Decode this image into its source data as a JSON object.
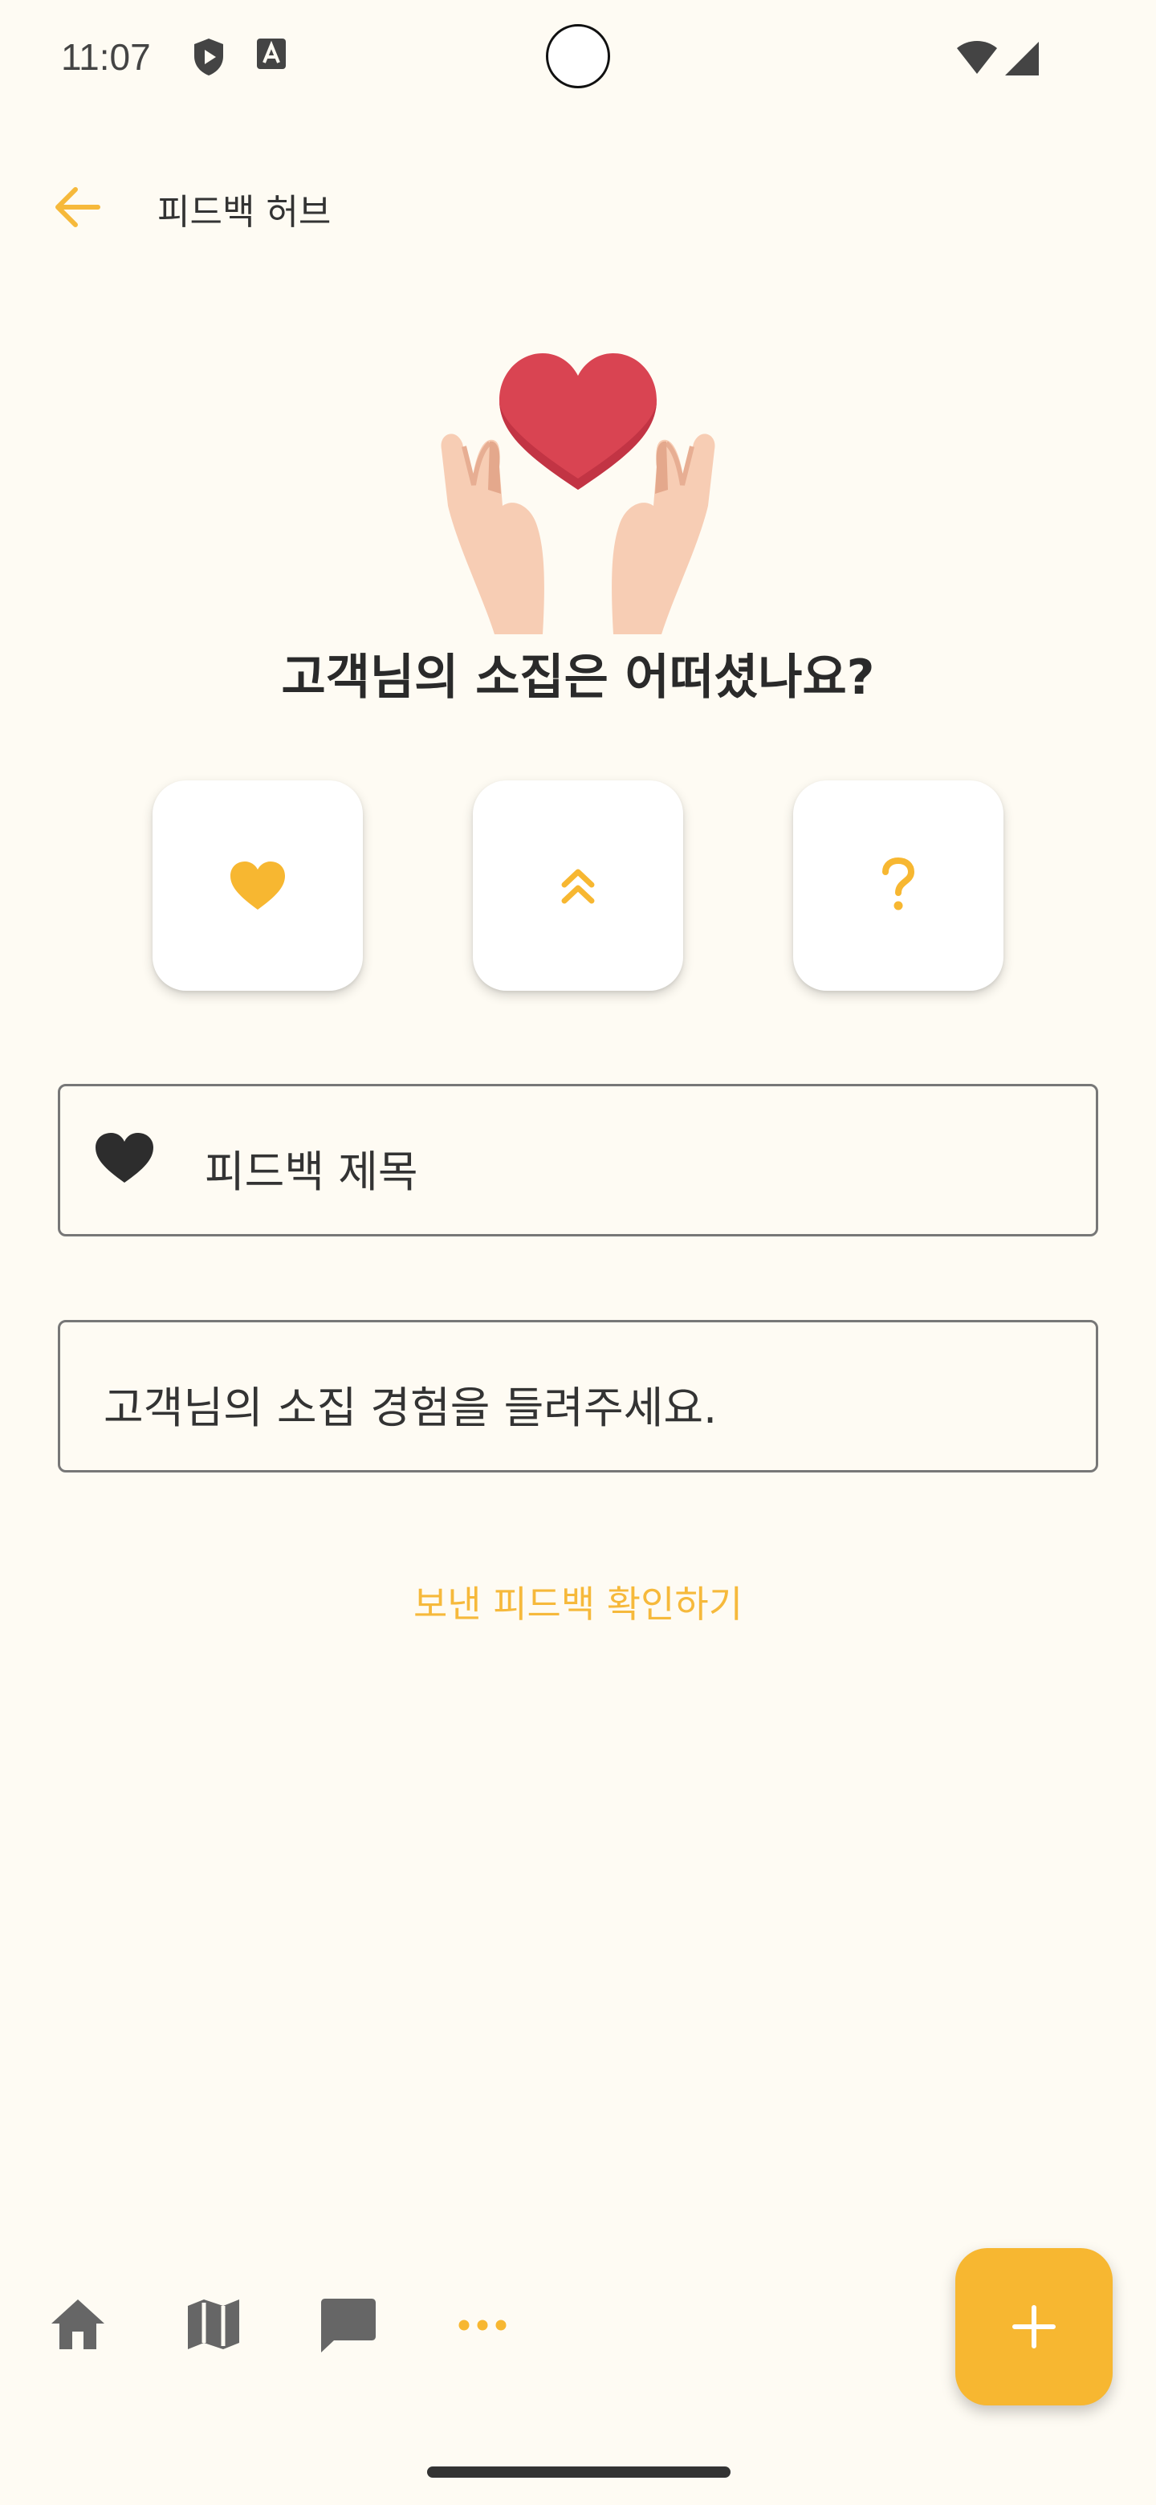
{
  "status_bar": {
    "time": "11:07"
  },
  "toolbar": {
    "title": "피드백 허브"
  },
  "main": {
    "question": "고객님의 소집은 어떠셨나요?",
    "categories": [
      {
        "icon": "heart-icon"
      },
      {
        "icon": "double-chevron-up-icon"
      },
      {
        "icon": "question-mark-icon"
      }
    ],
    "title_field": {
      "placeholder": "피드백 제목"
    },
    "body_field": {
      "placeholder": "고객님의 소집 경험을 들려주세요."
    },
    "sent_link": "보낸 피드백 확인하기"
  },
  "bottom_nav": {
    "items": [
      "home-icon",
      "map-icon",
      "chat-icon",
      "more-icon"
    ],
    "fab_icon": "plus-icon"
  },
  "colors": {
    "accent": "#F7B731",
    "background": "#FEFBF3",
    "heart_red": "#D94452"
  }
}
